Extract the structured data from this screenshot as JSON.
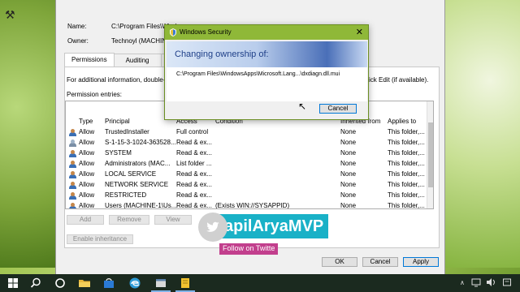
{
  "properties": {
    "name_label": "Name:",
    "name_value": "C:\\Program Files\\Windows",
    "owner_label": "Owner:",
    "owner_value": "Technoyl (MACHINE",
    "tabs": [
      {
        "label": "Permissions",
        "active": true
      },
      {
        "label": "Auditing",
        "active": false
      },
      {
        "label": "E",
        "active": false
      }
    ],
    "info_text": "For additional information, double-c",
    "info_text_right": "ick Edit (if available).",
    "entries_label": "Permission entries:",
    "columns": [
      "Type",
      "Principal",
      "Access",
      "Condition",
      "Inherited from",
      "Applies to"
    ],
    "rows": [
      {
        "type": "Allow",
        "principal": "TrustedInstaller",
        "access": "Full control",
        "condition": "",
        "inherited": "None",
        "applies": "This folder,..."
      },
      {
        "type": "Allow",
        "principal": "S-1-15-3-1024-363528...",
        "access": "Read & ex...",
        "condition": "",
        "inherited": "None",
        "applies": "This folder,..."
      },
      {
        "type": "Allow",
        "principal": "SYSTEM",
        "access": "Read & ex...",
        "condition": "",
        "inherited": "None",
        "applies": "This folder,..."
      },
      {
        "type": "Allow",
        "principal": "Administrators (MAC...",
        "access": "List folder ...",
        "condition": "",
        "inherited": "None",
        "applies": "This folder,..."
      },
      {
        "type": "Allow",
        "principal": "LOCAL SERVICE",
        "access": "Read & ex...",
        "condition": "",
        "inherited": "None",
        "applies": "This folder,..."
      },
      {
        "type": "Allow",
        "principal": "NETWORK SERVICE",
        "access": "Read & ex...",
        "condition": "",
        "inherited": "None",
        "applies": "This folder,..."
      },
      {
        "type": "Allow",
        "principal": "RESTRICTED",
        "access": "Read & ex...",
        "condition": "",
        "inherited": "None",
        "applies": "This folder,..."
      },
      {
        "type": "Allow",
        "principal": "Users (MACHINE-1\\Us...",
        "access": "Read & ex...",
        "condition": "(Exists WIN://SYSAPPID)",
        "inherited": "None",
        "applies": "This folder,..."
      }
    ],
    "buttons": {
      "add": "Add",
      "remove": "Remove",
      "view": "View",
      "enable_inheritance": "Enable inheritance",
      "ok": "OK",
      "cancel": "Cancel",
      "apply": "Apply"
    }
  },
  "dialog": {
    "title": "Windows Security",
    "heading": "Changing ownership of:",
    "path": "C:\\Program Files\\WindowsApps\\Microsoft.Lang...\\dxdiagn.dll.mui",
    "cancel": "Cancel"
  },
  "watermark": {
    "name": "apilAryaMVP",
    "follow": "Follow on Twitte"
  },
  "colors": {
    "dialog_titlebar": "#8fb838",
    "banner_accent": "#4a6fb8",
    "watermark_name_bg": "#19b1c7",
    "watermark_follow_bg": "#c23f8d",
    "taskbar": "#1b2a1f"
  }
}
